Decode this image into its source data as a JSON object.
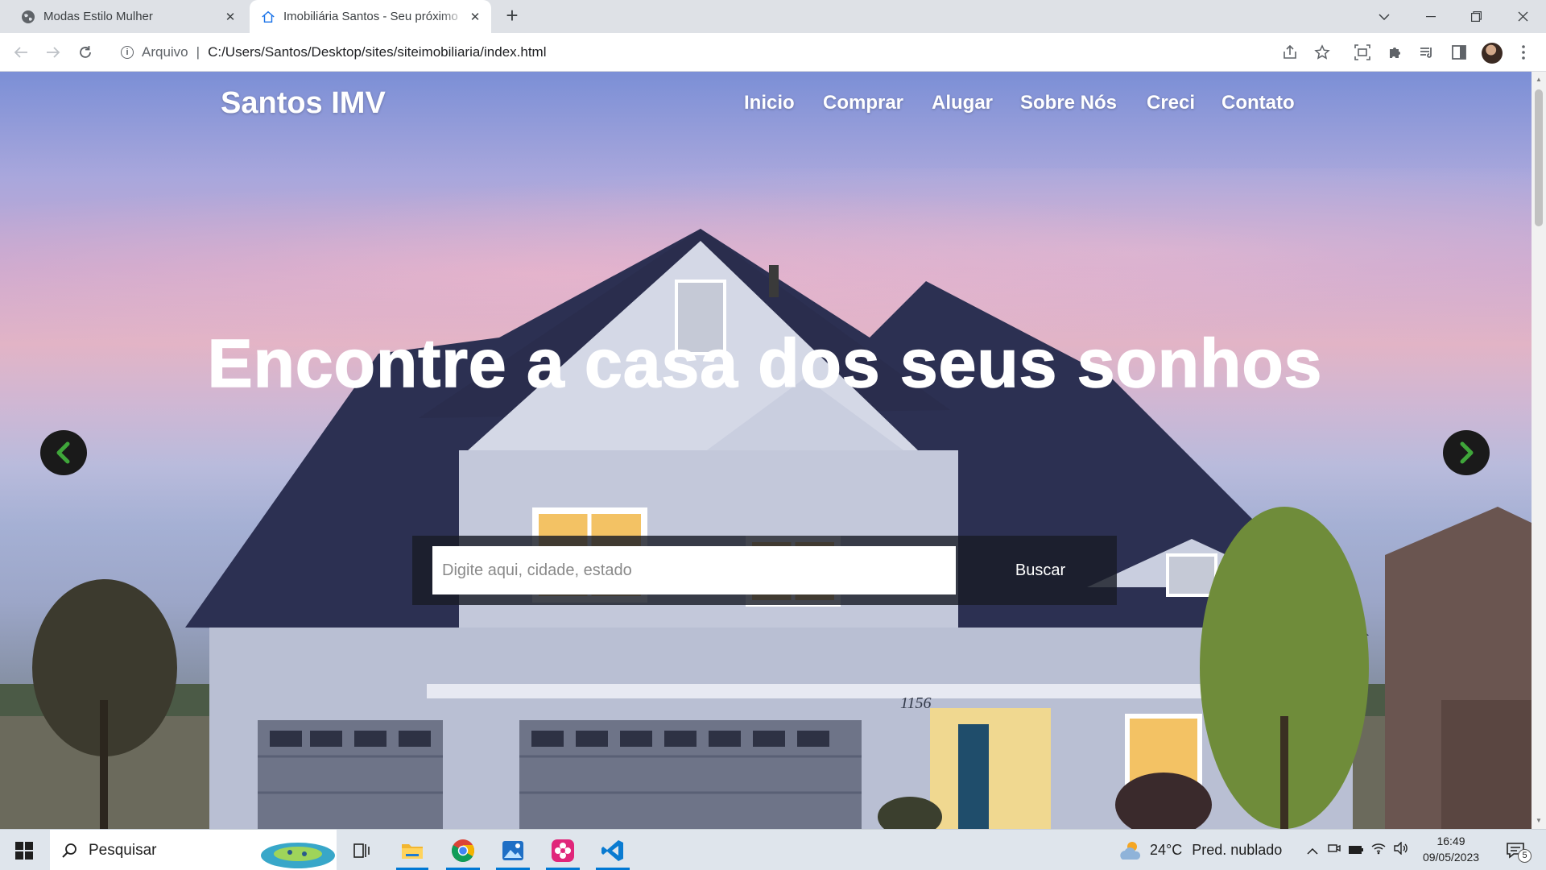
{
  "browser": {
    "tabs": [
      {
        "title": "Modas Estilo Mulher",
        "active": false
      },
      {
        "title": "Imobiliária Santos - Seu próximo",
        "active": true
      }
    ],
    "new_tab": "+",
    "address": {
      "protocol_label": "Arquivo",
      "separator": "|",
      "url": "C:/Users/Santos/Desktop/sites/siteimobiliaria/index.html"
    }
  },
  "site": {
    "brand": "Santos IMV",
    "nav": [
      "Inicio",
      "Comprar",
      "Alugar",
      "Sobre Nós",
      "Creci",
      "Contato"
    ],
    "headline": "Encontre a casa dos seus sonhos",
    "search": {
      "placeholder": "Digite aqui, cidade, estado",
      "button": "Buscar"
    },
    "house_number": "1156",
    "accent_color": "#3fa63a"
  },
  "taskbar": {
    "search_label": "Pesquisar",
    "weather": {
      "temp": "24°C",
      "condition": "Pred. nublado"
    },
    "time": "16:49",
    "date": "09/05/2023",
    "notification_count": "5"
  }
}
